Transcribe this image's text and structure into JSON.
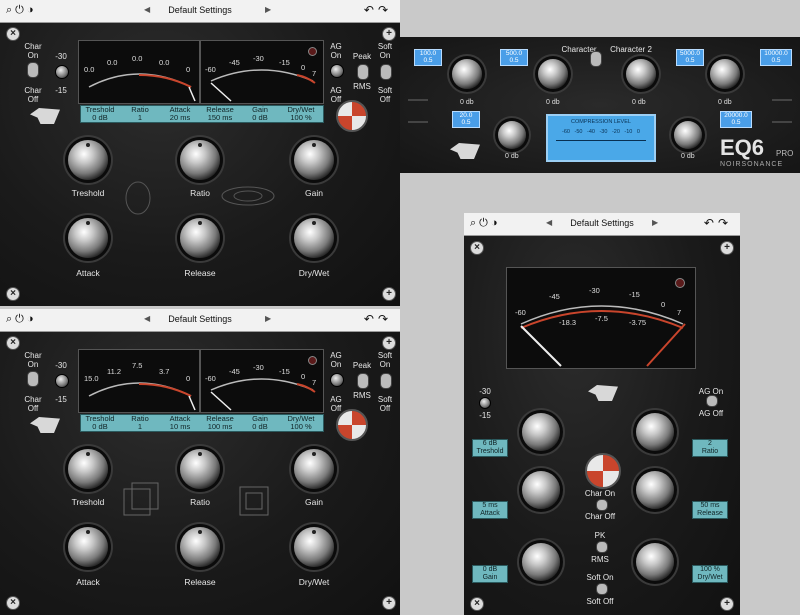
{
  "toolbar": {
    "preset_name": "Default Settings",
    "prev_icon": "triangle-left-icon",
    "next_icon": "triangle-right-icon",
    "undo_icon": "undo-icon",
    "redo_icon": "redo-icon"
  },
  "panel1": {
    "char_on": "Char\nOn",
    "char_off": "Char\nOff",
    "thr_top": "-30",
    "thr_bot": "-15",
    "ag_on": "AG\nOn",
    "ag_off": "AG\nOff",
    "peak": "Peak",
    "rms": "RMS",
    "soft_on": "Soft\nOn",
    "soft_off": "Soft\nOff",
    "gr_scale": [
      "0.0",
      "0.0",
      "0.0",
      "0.0",
      "0"
    ],
    "vu_scale": [
      "-60",
      "-45",
      "-30",
      "-15",
      "0",
      "7"
    ],
    "params": [
      {
        "name": "Treshold",
        "value": "0 dB"
      },
      {
        "name": "Ratio",
        "value": "1"
      },
      {
        "name": "Attack",
        "value": "20 ms"
      },
      {
        "name": "Release",
        "value": "150 ms"
      },
      {
        "name": "Gain",
        "value": "0 dB"
      },
      {
        "name": "Dry/Wet",
        "value": "100 %"
      }
    ],
    "knobs": [
      "Treshold",
      "Ratio",
      "Gain",
      "Attack",
      "Release",
      "Dry/Wet"
    ]
  },
  "panel2": {
    "char_on": "Char\nOn",
    "char_off": "Char\nOff",
    "thr_top": "-30",
    "thr_bot": "-15",
    "ag_on": "AG\nOn",
    "ag_off": "AG\nOff",
    "peak": "Peak",
    "rms": "RMS",
    "soft_on": "Soft\nOn",
    "soft_off": "Soft\nOff",
    "gr_scale": [
      "15.0",
      "11.2",
      "7.5",
      "3.7",
      "0"
    ],
    "vu_scale": [
      "-60",
      "-45",
      "-30",
      "-15",
      "0",
      "7"
    ],
    "params": [
      {
        "name": "Treshold",
        "value": "0 dB"
      },
      {
        "name": "Ratio",
        "value": "1"
      },
      {
        "name": "Attack",
        "value": "10 ms"
      },
      {
        "name": "Release",
        "value": "100 ms"
      },
      {
        "name": "Gain",
        "value": "0 dB"
      },
      {
        "name": "Dry/Wet",
        "value": "100 %"
      }
    ],
    "knobs": [
      "Treshold",
      "Ratio",
      "Gain",
      "Attack",
      "Release",
      "Dry/Wet"
    ]
  },
  "eq": {
    "boxes": [
      {
        "freq": "100.0",
        "q": "0.5"
      },
      {
        "freq": "500.0",
        "q": "0.5"
      },
      {
        "freq": "5000.0",
        "q": "0.5"
      },
      {
        "freq": "10000.0",
        "q": "0.5"
      },
      {
        "freq": "20.0",
        "q": "0.5"
      },
      {
        "freq": "20000.0",
        "q": "0.5"
      }
    ],
    "char_label": "Character",
    "char2_label": "Character 2",
    "db_labels": [
      "0 db",
      "0 db",
      "0 db",
      "0 db",
      "0 db",
      "0 db"
    ],
    "meter_title": "COMPRESSION LEVEL",
    "meter_scale": "-60 -50 -40 -30 -20 -10 0",
    "logo_main": "EQ6",
    "logo_sub": "PRO",
    "brand": "NOIRSONANCE"
  },
  "panel3": {
    "vu_scale": [
      "-60",
      "-45",
      "-30",
      "-15",
      "0",
      "7"
    ],
    "vu_inner": [
      "-18.3",
      "-7.5",
      "-3.75"
    ],
    "thr_top": "-30",
    "thr_bot": "-15",
    "ag_on": "AG On",
    "ag_off": "AG Off",
    "char_on": "Char On",
    "char_off": "Char Off",
    "pk": "PK",
    "rms": "RMS",
    "soft_on": "Soft On",
    "soft_off": "Soft Off",
    "tags": [
      {
        "value": "6 dB",
        "name": "Treshold"
      },
      {
        "value": "2",
        "name": "Ratio"
      },
      {
        "value": "5 ms",
        "name": "Attack"
      },
      {
        "value": "50 ms",
        "name": "Release"
      },
      {
        "value": "0 dB",
        "name": "Gain"
      },
      {
        "value": "100 %",
        "name": "Dry/Wet"
      }
    ]
  },
  "colors": {
    "accent_teal": "#6fb8bf",
    "eq_blue": "#4a9ee8",
    "badge_red": "#c9452c"
  }
}
